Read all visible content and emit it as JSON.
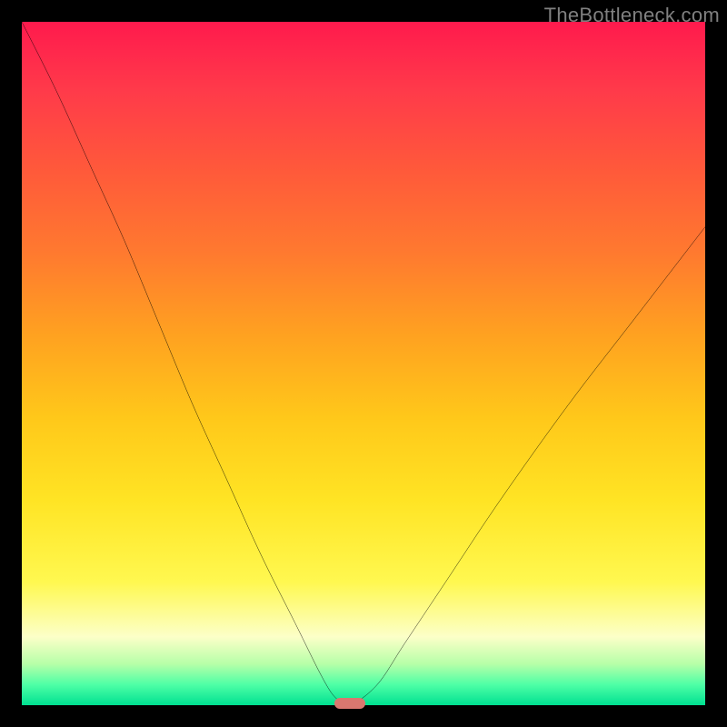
{
  "watermark": "TheBottleneck.com",
  "chart_data": {
    "type": "line",
    "title": "",
    "xlabel": "",
    "ylabel": "",
    "x_range": [
      0,
      100
    ],
    "y_range": [
      0,
      100
    ],
    "series": [
      {
        "name": "bottleneck-curve",
        "x": [
          0,
          5,
          10,
          15,
          20,
          25,
          30,
          35,
          40,
          44,
          46,
          48,
          52,
          56,
          62,
          70,
          80,
          90,
          100
        ],
        "y": [
          100,
          90,
          79,
          68,
          56,
          44,
          33,
          22,
          12,
          4,
          1,
          0,
          3,
          9,
          18,
          30,
          44,
          57,
          70
        ]
      }
    ],
    "marker": {
      "x": 48,
      "y": 0.3
    },
    "gradient_stops": [
      {
        "pos": 0,
        "color": "#ff1a4d"
      },
      {
        "pos": 50,
        "color": "#ffc81a"
      },
      {
        "pos": 90,
        "color": "#fcffc8"
      },
      {
        "pos": 100,
        "color": "#00e091"
      }
    ]
  }
}
